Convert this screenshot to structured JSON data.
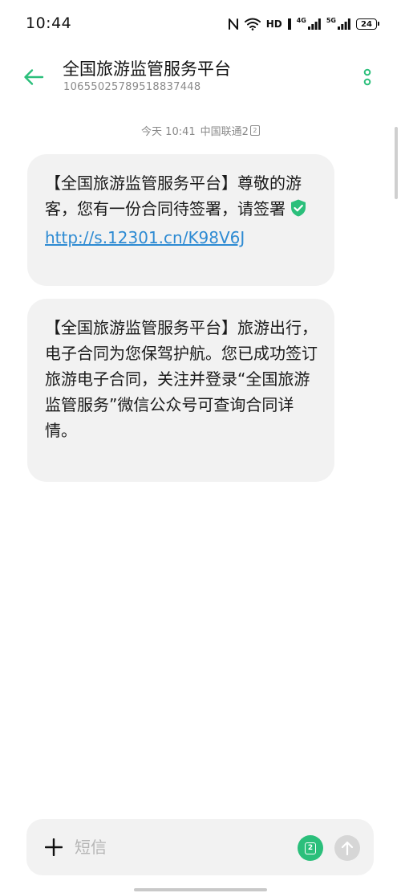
{
  "status_bar": {
    "time": "10:44",
    "hd_label": "HD",
    "network_4g": "4G",
    "network_5g": "5G",
    "battery": "24"
  },
  "header": {
    "contact_name": "全国旅游监管服务平台",
    "contact_number": "10655025789518837448"
  },
  "thread": {
    "timestamp": "今天 10:41",
    "carrier": "中国联通2",
    "sim_slot": "2",
    "messages": [
      {
        "text": "【全国旅游监管服务平台】尊敬的游客，您有一份合同待签署，请签署",
        "link": "http://s.12301.cn/K98V6J"
      },
      {
        "text": "【全国旅游监管服务平台】旅游出行，电子合同为您保驾护航。您已成功签订旅游电子合同，关注并登录“全国旅游监管服务”微信公众号可查询合同详情。"
      }
    ]
  },
  "composer": {
    "placeholder": "短信",
    "sim_slot": "2"
  },
  "colors": {
    "accent": "#2bbf7b",
    "link": "#2e8bd3",
    "bubble": "#f2f2f2",
    "muted": "#8a8a8a"
  },
  "icons": {
    "back": "arrow-left-icon",
    "more": "more-vertical-icon",
    "verified": "shield-check-icon",
    "add": "plus-icon",
    "send": "arrow-up-icon"
  }
}
